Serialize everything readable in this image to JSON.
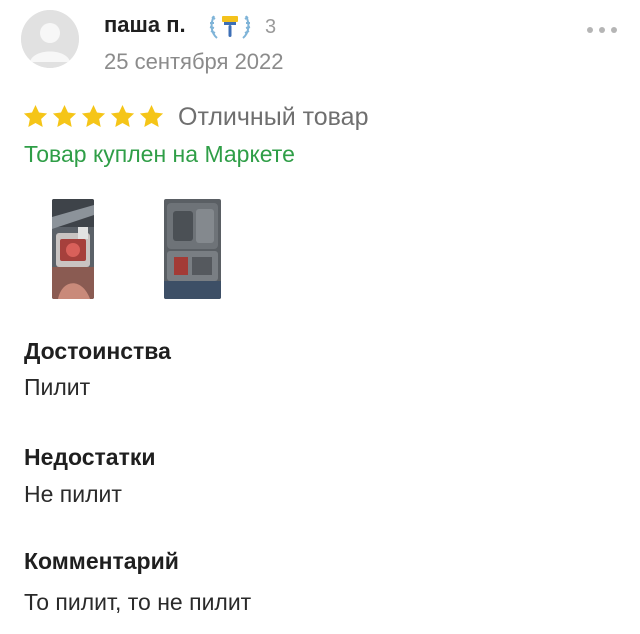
{
  "review": {
    "author": {
      "name": "паша п.",
      "badge_icon": "paintbrush-badge-icon",
      "badge_count": "3"
    },
    "date": "25 сентября 2022",
    "rating": {
      "stars": 5,
      "max_stars": 5,
      "label": "Отличный товар",
      "star_color": "#f5c518"
    },
    "purchase_note": "Товар куплен на Маркете",
    "photos_count": 2,
    "sections": [
      {
        "title": "Достоинства",
        "text": "Пилит"
      },
      {
        "title": "Недостатки",
        "text": "Не пилит"
      },
      {
        "title": "Комментарий",
        "text": "То пилит, то не пилит"
      }
    ]
  },
  "colors": {
    "accent_green": "#2f9e47",
    "muted_text": "#8b8b8b"
  }
}
